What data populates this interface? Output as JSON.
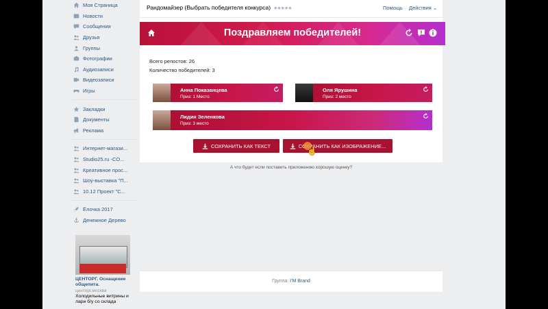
{
  "sidebar": {
    "main_items": [
      {
        "label": "Моя Страница",
        "icon": "home-icon"
      },
      {
        "label": "Новости",
        "icon": "news-icon"
      },
      {
        "label": "Сообщения",
        "icon": "messages-icon"
      },
      {
        "label": "Друзья",
        "icon": "friends-icon"
      },
      {
        "label": "Группы",
        "icon": "groups-icon"
      },
      {
        "label": "Фотографии",
        "icon": "camera-icon"
      },
      {
        "label": "Аудиозаписи",
        "icon": "music-icon"
      },
      {
        "label": "Видеозаписи",
        "icon": "video-icon"
      },
      {
        "label": "Игры",
        "icon": "gamepad-icon"
      }
    ],
    "secondary_items": [
      {
        "label": "Закладки",
        "icon": "star-icon"
      },
      {
        "label": "Документы",
        "icon": "document-icon"
      },
      {
        "label": "Реклама",
        "icon": "megaphone-icon"
      }
    ],
    "group_items": [
      {
        "label": "Интернет-магази...",
        "icon": "group-icon"
      },
      {
        "label": "Studio25.ru -CO...",
        "icon": "group-icon"
      },
      {
        "label": "Креативное прос...",
        "icon": "group-icon"
      },
      {
        "label": "Шоу-выставка \"П...",
        "icon": "group-icon"
      },
      {
        "label": "10.12 Проект \"С...",
        "icon": "group-icon"
      }
    ],
    "app_items": [
      {
        "label": "Ёлочка 2017",
        "icon": "rocket-icon"
      },
      {
        "label": "Денежное Дерево",
        "icon": "anchor-icon"
      }
    ],
    "ad": {
      "title": "ЦЕНТОРГ. Оснащение общепита.",
      "domain": "центорг.москва",
      "text": "Холодильные витрины и лари б/у со склада"
    }
  },
  "header": {
    "title": "Рандомайзер (Выбрать победителя конкурса)",
    "stars": "★★★★★",
    "help": "Помощь",
    "actions": "Действия"
  },
  "banner": {
    "title": "Поздравляем победителей!"
  },
  "stats": {
    "reposts": "Всего репостов: 26",
    "winners_count": "Количество победителей: 3"
  },
  "winners": [
    {
      "name": "Анна Показанцева",
      "prize": "Приз: 1 Место"
    },
    {
      "name": "Оля Ярушина",
      "prize": "Приз: 2 место"
    },
    {
      "name": "Лидия Зеленкова",
      "prize": "Приз: 3 место"
    }
  ],
  "buttons": {
    "save_text": "СОХРАНИТЬ КАК ТЕКСТ",
    "save_image": "СОХРАНИТЬ КАК ИЗОБРАЖЕНИЕ..."
  },
  "rating_prompt": "А что будет если поставить приложению хорошую оценку?",
  "footer": {
    "prefix": "Группа:",
    "group": "I'M Brand"
  },
  "colors": {
    "accent": "#c8164a",
    "link": "#2a5885",
    "button": "#a8112f"
  }
}
